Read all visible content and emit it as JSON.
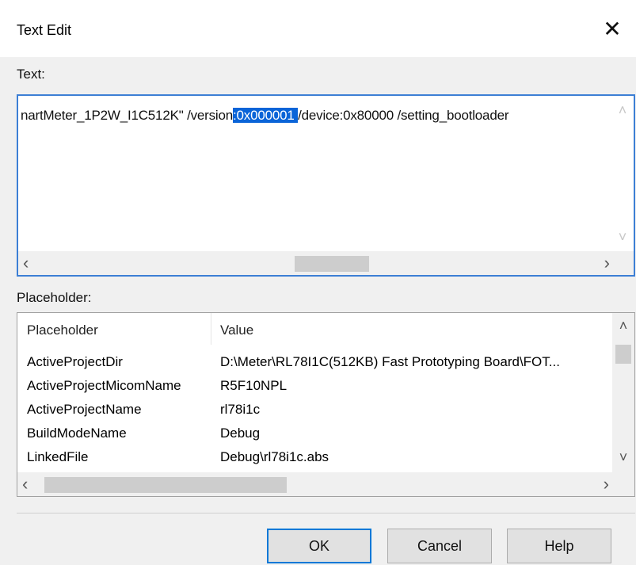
{
  "window": {
    "title": "Text Edit",
    "close_icon": "close-icon"
  },
  "text_section": {
    "label": "Text:",
    "content_before": "nartMeter_1P2W_I1C512K\" /version",
    "selected": ":0x000001 ",
    "content_after": "/device:0x80000 /setting_bootloader"
  },
  "placeholder_section": {
    "label": "Placeholder:",
    "columns": [
      "Placeholder",
      "Value"
    ],
    "rows": [
      {
        "name": "ActiveProjectDir",
        "value": "D:\\Meter\\RL78I1C(512KB) Fast Prototyping Board\\FOT..."
      },
      {
        "name": "ActiveProjectMicomName",
        "value": "R5F10NPL"
      },
      {
        "name": "ActiveProjectName",
        "value": "rl78i1c"
      },
      {
        "name": "BuildModeName",
        "value": "Debug"
      },
      {
        "name": "LinkedFile",
        "value": "Debug\\rl78i1c.abs"
      }
    ]
  },
  "buttons": {
    "ok": "OK",
    "cancel": "Cancel",
    "help": "Help"
  },
  "colors": {
    "accent": "#0078d7",
    "selection": "#0a64d8"
  }
}
